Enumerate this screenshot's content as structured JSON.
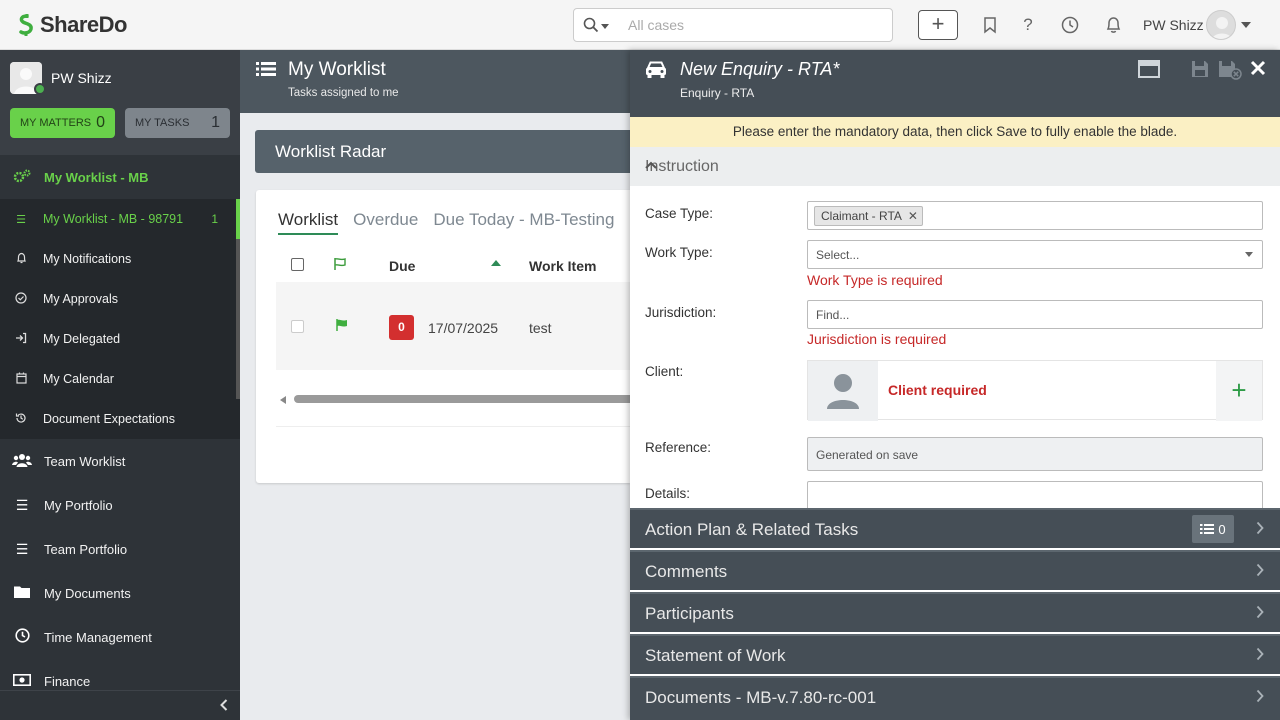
{
  "app": {
    "logo_text": "ShareDo",
    "search_placeholder": "All cases",
    "user_name": "PW Shizz"
  },
  "sidebar": {
    "profile_name": "PW Shizz",
    "matters_label": "My Matters",
    "matters_count": "0",
    "tasks_label": "My Tasks",
    "tasks_count": "1",
    "items": [
      {
        "label": "My Worklist - MB",
        "icon": "cogs-icon"
      },
      {
        "label": "My Worklist - MB - 98791",
        "count": "1",
        "icon": "list-icon"
      },
      {
        "label": "My Notifications",
        "icon": "bell-icon"
      },
      {
        "label": "My Approvals",
        "icon": "check-circle-icon"
      },
      {
        "label": "My Delegated",
        "icon": "sign-in-icon"
      },
      {
        "label": "My Calendar",
        "icon": "calendar-icon"
      },
      {
        "label": "Document Expectations",
        "icon": "history-icon"
      },
      {
        "label": "Team Worklist",
        "icon": "users-icon"
      },
      {
        "label": "My Portfolio",
        "icon": "list-icon"
      },
      {
        "label": "Team Portfolio",
        "icon": "list-icon"
      },
      {
        "label": "My Documents",
        "icon": "folder-icon"
      },
      {
        "label": "Time Management",
        "icon": "clock-icon"
      },
      {
        "label": "Finance",
        "icon": "money-icon"
      }
    ]
  },
  "main": {
    "title": "My Worklist",
    "subtitle": "Tasks assigned to me",
    "radar_title": "Worklist Radar",
    "tabs": [
      "Worklist",
      "Overdue",
      "Due Today - MB-Testing"
    ],
    "columns": {
      "due": "Due",
      "work_item": "Work Item"
    },
    "rows": [
      {
        "overdue": "0",
        "date": "17/07/2025",
        "work_item": "test"
      }
    ]
  },
  "blade": {
    "title": "New Enquiry - RTA*",
    "subtitle": "Enquiry - RTA",
    "warning": "Please enter the mandatory data, then click Save to fully enable the blade.",
    "section_instruction": "Instruction",
    "fields": {
      "case_type_label": "Case Type:",
      "case_type_tag": "Claimant - RTA",
      "work_type_label": "Work Type:",
      "work_type_placeholder": "Select...",
      "work_type_error": "Work Type is required",
      "jurisdiction_label": "Jurisdiction:",
      "jurisdiction_placeholder": "Find...",
      "jurisdiction_error": "Jurisdiction is required",
      "client_label": "Client:",
      "client_required": "Client required",
      "reference_label": "Reference:",
      "reference_value": "Generated on save",
      "details_label": "Details:"
    },
    "accordions": [
      {
        "title": "Action Plan & Related Tasks",
        "badge": "0"
      },
      {
        "title": "Comments"
      },
      {
        "title": "Participants"
      },
      {
        "title": "Statement of Work"
      },
      {
        "title": "Documents - MB-v.7.80-rc-001"
      }
    ]
  },
  "colors": {
    "accent_green": "#69d14a",
    "sidebar_bg": "#2e3338",
    "blade_header": "#454e56",
    "error_red": "#c62828",
    "warning_bg": "#fbf0c4"
  }
}
